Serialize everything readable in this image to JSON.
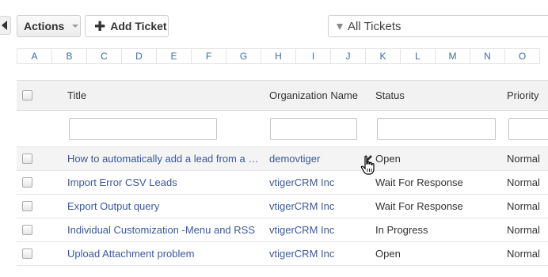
{
  "toolbar": {
    "actions_label": "Actions",
    "add_ticket_label": "Add Ticket",
    "filter_label": "All Tickets"
  },
  "alphabet": [
    "A",
    "B",
    "C",
    "D",
    "E",
    "F",
    "G",
    "H",
    "I",
    "J",
    "K",
    "L",
    "M",
    "N",
    "O"
  ],
  "table": {
    "columns": {
      "title": "Title",
      "organization": "Organization Name",
      "status": "Status",
      "priority": "Priority"
    },
    "rows": [
      {
        "title": "How to automatically add a lead from a w...",
        "organization": "demovtiger",
        "status": "Open",
        "priority": "Normal"
      },
      {
        "title": "Import Error CSV Leads",
        "organization": "vtigerCRM Inc",
        "status": "Wait For Response",
        "priority": "Normal"
      },
      {
        "title": "Export Output query",
        "organization": "vtigerCRM Inc",
        "status": "Wait For Response",
        "priority": "Normal"
      },
      {
        "title": "Individual Customization -Menu and RSS",
        "organization": "vtigerCRM Inc",
        "status": "In Progress",
        "priority": "Normal"
      },
      {
        "title": "Upload Attachment problem",
        "organization": "vtigerCRM Inc",
        "status": "Open",
        "priority": "Normal"
      }
    ]
  },
  "icons": {
    "collapse": "chevron-left-icon",
    "add": "plus-icon",
    "filter": "funnel-icon",
    "edit": "pencil-icon",
    "cursor": "hand-pointer-icon"
  },
  "colors": {
    "link": "#3b5998",
    "alpha_link": "#3b6ea5",
    "header_bg": "#f2f2f2",
    "hover_row_bg": "#f4f4f4"
  }
}
